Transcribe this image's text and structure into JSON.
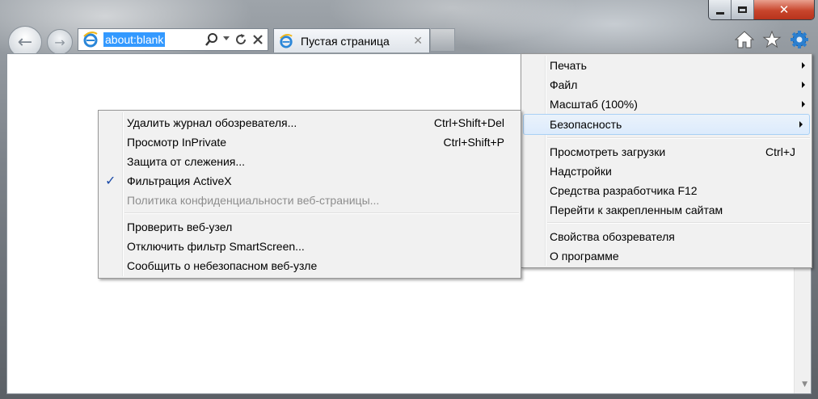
{
  "window": {
    "caption": {
      "minimize_icon": "minimize-icon",
      "maximize_icon": "maximize-icon",
      "close_icon": "close-icon",
      "close_glyph": "✕"
    }
  },
  "nav": {
    "back_glyph": "←",
    "forward_glyph": "→"
  },
  "address": {
    "url": "about:blank"
  },
  "tab": {
    "title": "Пустая страница",
    "close_glyph": "✕"
  },
  "tools_menu": {
    "items": [
      {
        "label": "Печать",
        "submenu": true
      },
      {
        "label": "Файл",
        "submenu": true
      },
      {
        "label": "Масштаб (100%)",
        "submenu": true
      },
      {
        "label": "Безопасность",
        "submenu": true,
        "highlighted": true
      },
      {
        "label": "Просмотреть загрузки",
        "shortcut": "Ctrl+J"
      },
      {
        "label": "Надстройки"
      },
      {
        "label": "Средства разработчика F12"
      },
      {
        "label": "Перейти к закрепленным сайтам"
      },
      {
        "label": "Свойства обозревателя"
      },
      {
        "label": "О программе"
      }
    ]
  },
  "safety_menu": {
    "items": [
      {
        "label": "Удалить журнал обозревателя...",
        "shortcut": "Ctrl+Shift+Del"
      },
      {
        "label": "Просмотр InPrivate",
        "shortcut": "Ctrl+Shift+P"
      },
      {
        "label": "Защита от слежения..."
      },
      {
        "label": "Фильтрация ActiveX",
        "checked": true
      },
      {
        "label": "Политика конфиденциальности веб-страницы...",
        "disabled": true
      },
      {
        "label": "Проверить веб-узел"
      },
      {
        "label": "Отключить фильтр SmartScreen..."
      },
      {
        "label": "Сообщить о небезопасном веб-узле"
      }
    ],
    "check_glyph": "✓"
  },
  "colors": {
    "highlight": "#dcebfc",
    "selection": "#3399ff",
    "close_button": "#c8452c"
  }
}
